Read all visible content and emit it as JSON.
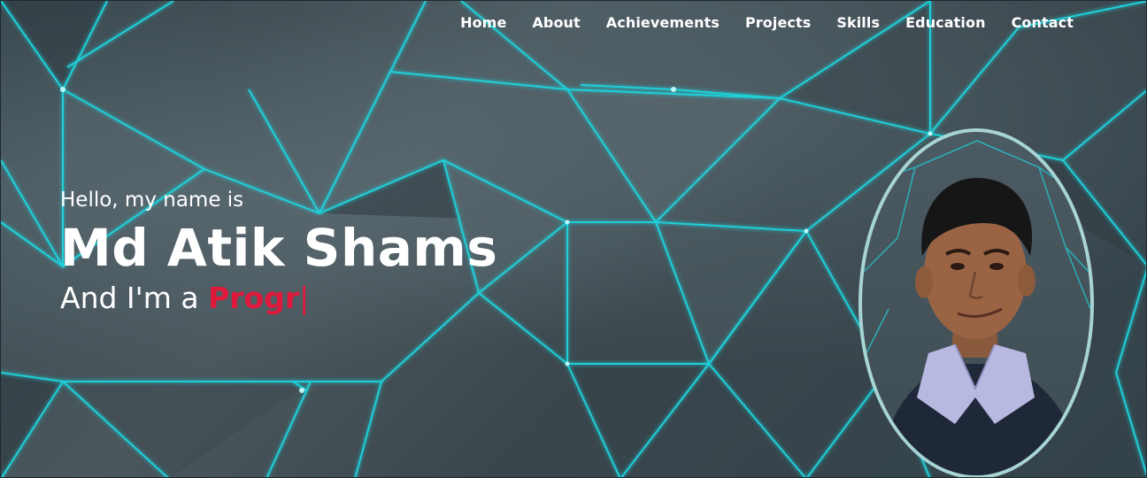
{
  "nav": {
    "items": [
      {
        "label": "Home"
      },
      {
        "label": "About"
      },
      {
        "label": "Achievements"
      },
      {
        "label": "Projects"
      },
      {
        "label": "Skills"
      },
      {
        "label": "Education"
      },
      {
        "label": "Contact"
      }
    ]
  },
  "hero": {
    "greeting": "Hello, my name is",
    "name": "Md Atik Shams",
    "role_prefix": "And I'm a ",
    "role_typed": "Progr",
    "cursor": "|"
  },
  "colors": {
    "accent": "#e0183c",
    "glow": "#1fd6e0",
    "portrait_border": "#a7d4d4",
    "text": "#ffffff"
  },
  "icons": {
    "portrait": "profile-photo"
  }
}
